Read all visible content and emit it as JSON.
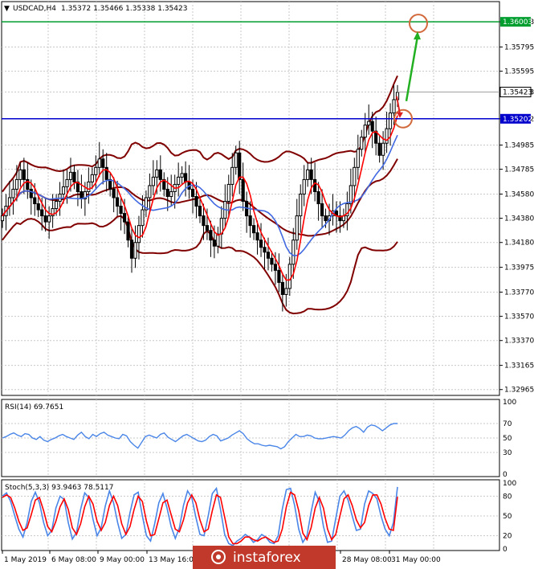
{
  "header": {
    "symbol": "USDCAD,H4",
    "ohlc": "1.35372 1.35466 1.35338 1.35423"
  },
  "colors": {
    "candle": "#000000",
    "bollinger": "#800000",
    "ma_fast": "#ff0000",
    "ma_slow": "#4169e1",
    "resistance": "#009e2f",
    "support": "#0000cc",
    "arrow_up": "#22b022",
    "arrow_down": "#dd2020",
    "circle": "#d2693c",
    "rsi_line": "#4a86e8",
    "stoch_main": "#4a86e8",
    "stoch_signal": "#ff0000",
    "watermark_bg": "#c0392b"
  },
  "chart_data": [
    {
      "type": "candlestick",
      "panel": "main",
      "ylim": [
        1.3293,
        1.3615
      ],
      "y_ticks": [
        "1.36003",
        "1.35795",
        "1.35595",
        "1.35423",
        "1.35202",
        "1.34985",
        "1.34785",
        "1.34580",
        "1.34380",
        "1.34180",
        "1.33975",
        "1.33770",
        "1.33570",
        "1.33370",
        "1.33165",
        "1.32965"
      ],
      "indicators": [
        "Bollinger Bands",
        "Moving Average (fast)",
        "Moving Average (slow)"
      ],
      "levels": [
        {
          "label": "1.36003",
          "value": 1.36003,
          "color": "#009e2f"
        },
        {
          "label": "1.35202",
          "value": 1.35202,
          "color": "#0000cc"
        }
      ],
      "current_price": {
        "label": "1.35423",
        "value": 1.35423
      },
      "annotations": [
        "green arrow pointing up towards circled target at 1.36003",
        "red arrow pointing down towards circled support at 1.35202"
      ],
      "close_series": [
        1.344,
        1.3448,
        1.3455,
        1.3462,
        1.347,
        1.3478,
        1.347,
        1.3462,
        1.3455,
        1.345,
        1.3445,
        1.344,
        1.3435,
        1.344,
        1.3446,
        1.3452,
        1.3458,
        1.3464,
        1.347,
        1.3476,
        1.3468,
        1.346,
        1.3454,
        1.346,
        1.3468,
        1.3474,
        1.348,
        1.3487,
        1.348,
        1.347,
        1.3462,
        1.3455,
        1.3448,
        1.3442,
        1.3435,
        1.342,
        1.3405,
        1.3418,
        1.3432,
        1.3445,
        1.3455,
        1.3465,
        1.3472,
        1.3478,
        1.347,
        1.3462,
        1.3456,
        1.346,
        1.3466,
        1.3472,
        1.3475,
        1.3468,
        1.3462,
        1.3456,
        1.3448,
        1.344,
        1.3432,
        1.3428,
        1.342,
        1.3415,
        1.3425,
        1.3438,
        1.3452,
        1.3466,
        1.348,
        1.3492,
        1.347,
        1.3452,
        1.344,
        1.3432,
        1.3426,
        1.342,
        1.3414,
        1.341,
        1.3405,
        1.34,
        1.3395,
        1.3385,
        1.3375,
        1.338,
        1.34,
        1.342,
        1.344,
        1.3458,
        1.347,
        1.3478,
        1.347,
        1.346,
        1.345,
        1.344,
        1.3436,
        1.344,
        1.3444,
        1.344,
        1.3436,
        1.344,
        1.345,
        1.3465,
        1.348,
        1.3495,
        1.3505,
        1.3515,
        1.3518,
        1.351,
        1.35,
        1.349,
        1.35,
        1.3512,
        1.3525,
        1.3536,
        1.3542
      ],
      "x_labels": [
        "1 May 2019",
        "6 May 08:00",
        "9 May 00:00",
        "13 May 16:00",
        "28 May 08:00",
        "31 May 00:00"
      ]
    },
    {
      "type": "line",
      "panel": "rsi",
      "title": "RSI(14) 69.7651",
      "ylim": [
        0,
        100
      ],
      "y_ticks": [
        "100",
        "70",
        "50",
        "30",
        "0"
      ],
      "series": [
        {
          "name": "RSI(14)",
          "values": [
            50,
            52,
            55,
            57,
            54,
            52,
            56,
            55,
            50,
            48,
            52,
            47,
            45,
            48,
            50,
            53,
            55,
            52,
            50,
            48,
            54,
            58,
            52,
            49,
            55,
            52,
            56,
            58,
            54,
            52,
            50,
            49,
            55,
            53,
            45,
            40,
            36,
            44,
            52,
            54,
            52,
            50,
            55,
            57,
            51,
            48,
            45,
            49,
            53,
            55,
            52,
            49,
            46,
            45,
            47,
            52,
            55,
            53,
            46,
            48,
            50,
            54,
            57,
            60,
            56,
            49,
            45,
            42,
            42,
            40,
            39,
            40,
            39,
            38,
            35,
            38,
            45,
            50,
            55,
            52,
            52,
            54,
            53,
            50,
            49,
            49,
            50,
            51,
            52,
            51,
            50,
            54,
            60,
            64,
            66,
            63,
            58,
            65,
            68,
            67,
            64,
            60,
            64,
            68,
            70,
            70
          ]
        }
      ]
    },
    {
      "type": "line",
      "panel": "stochastic",
      "title": "Stoch(5,3,3) 93.9463 78.5117",
      "ylim": [
        0,
        100
      ],
      "y_ticks": [
        "100",
        "80",
        "50",
        "20",
        "0"
      ],
      "series": [
        {
          "name": "main",
          "values": [
            80,
            85,
            72,
            50,
            30,
            18,
            40,
            72,
            86,
            70,
            40,
            20,
            28,
            62,
            80,
            75,
            40,
            15,
            25,
            60,
            85,
            78,
            45,
            20,
            32,
            65,
            88,
            70,
            40,
            16,
            22,
            55,
            82,
            86,
            50,
            20,
            12,
            38,
            70,
            84,
            62,
            34,
            16,
            32,
            66,
            88,
            78,
            48,
            22,
            20,
            50,
            84,
            92,
            60,
            22,
            8,
            5,
            12,
            16,
            22,
            18,
            10,
            14,
            22,
            18,
            10,
            8,
            20,
            60,
            90,
            92,
            66,
            30,
            10,
            20,
            56,
            86,
            72,
            34,
            10,
            12,
            46,
            80,
            88,
            74,
            50,
            28,
            30,
            68,
            88,
            84,
            76,
            50,
            30,
            20,
            40,
            94
          ]
        },
        {
          "name": "signal",
          "values": [
            78,
            82,
            78,
            62,
            42,
            28,
            32,
            52,
            74,
            78,
            58,
            34,
            26,
            42,
            64,
            76,
            60,
            32,
            22,
            38,
            64,
            80,
            68,
            42,
            28,
            40,
            66,
            80,
            66,
            38,
            22,
            34,
            60,
            80,
            72,
            42,
            20,
            22,
            46,
            70,
            74,
            52,
            30,
            26,
            44,
            70,
            82,
            70,
            44,
            26,
            30,
            58,
            82,
            78,
            48,
            18,
            8,
            8,
            12,
            18,
            18,
            14,
            12,
            16,
            18,
            14,
            10,
            12,
            30,
            64,
            86,
            82,
            58,
            24,
            14,
            32,
            62,
            78,
            62,
            30,
            14,
            22,
            50,
            76,
            82,
            66,
            44,
            32,
            40,
            66,
            82,
            82,
            68,
            46,
            30,
            28,
            79
          ]
        }
      ]
    }
  ],
  "watermark": {
    "text": "instaforex"
  }
}
